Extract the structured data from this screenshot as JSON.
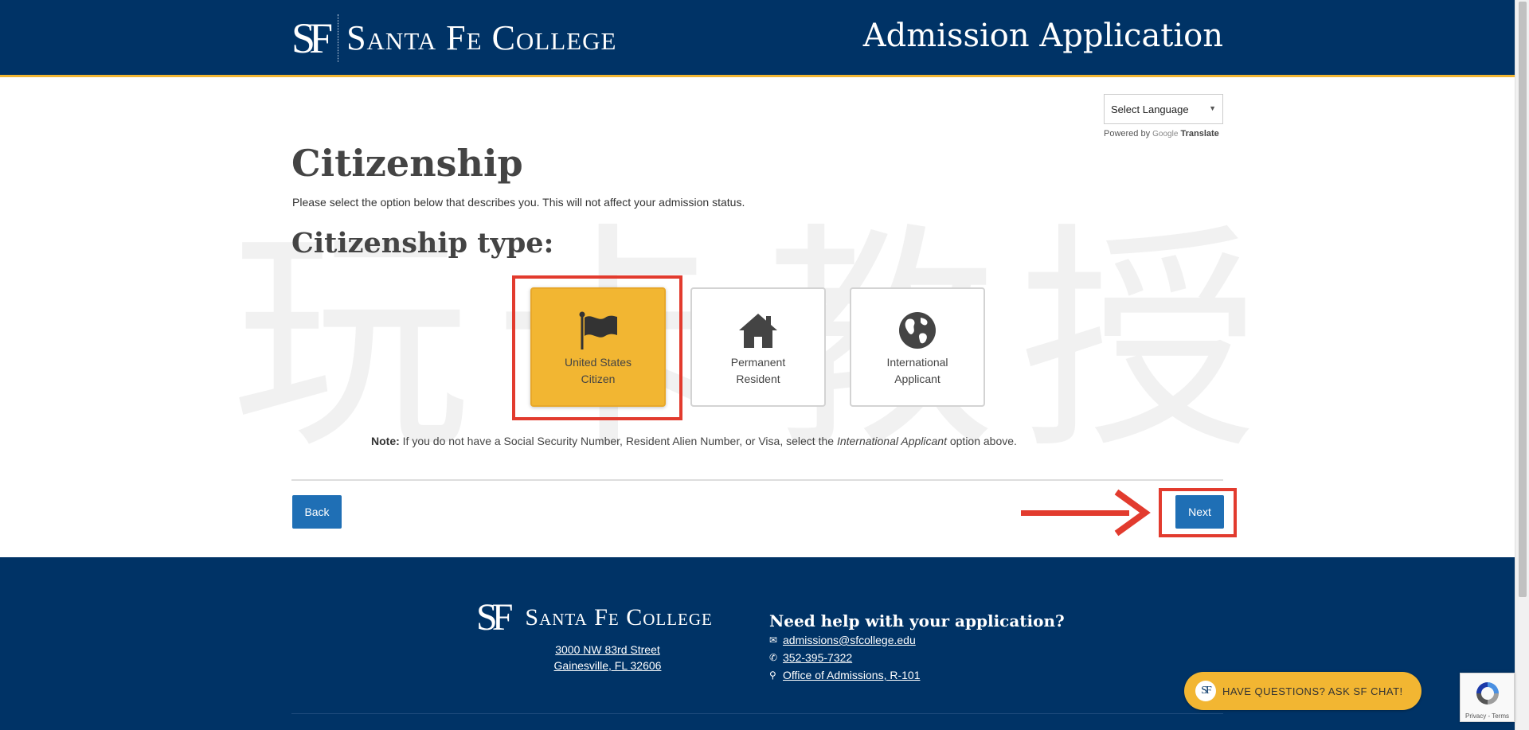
{
  "header": {
    "logo_mark": "SF",
    "logo_text": "Santa Fe College",
    "title": "Admission Application"
  },
  "language": {
    "select_label": "Select Language",
    "powered_by": "Powered by",
    "google": "Google",
    "translate": "Translate"
  },
  "main": {
    "page_title": "Citizenship",
    "intro": "Please select the option below that describes you. This will not affect your admission status.",
    "type_title": "Citizenship type:",
    "options": [
      {
        "label": "United States Citizen",
        "icon": "flag-icon",
        "selected": true
      },
      {
        "label": "Permanent Resident",
        "icon": "house-icon",
        "selected": false
      },
      {
        "label": "International Applicant",
        "icon": "globe-icon",
        "selected": false
      }
    ],
    "note_label": "Note:",
    "note_text_before": " If you do not have a Social Security Number, Resident Alien Number, or Visa, select the ",
    "note_emphasis": "International Applicant",
    "note_text_after": " option above.",
    "back_label": "Back",
    "next_label": "Next"
  },
  "watermark": "玩卡教授",
  "footer": {
    "logo_mark": "SF",
    "logo_text": "Santa Fe College",
    "address_line1": "3000 NW 83rd Street",
    "address_line2": "Gainesville, FL 32606",
    "help_title": "Need help with your application?",
    "email": "admissions@sfcollege.edu",
    "phone": "352-395-7322",
    "office": "Office of Admissions, R-101"
  },
  "chat": {
    "logo_mark": "SF",
    "label": "HAVE QUESTIONS? ASK SF CHAT!"
  },
  "recaptcha": {
    "text": "Privacy - Terms"
  },
  "colors": {
    "navy": "#003366",
    "gold": "#f2b632",
    "button_blue": "#1f6fb5",
    "annotation_red": "#e23b2e"
  }
}
